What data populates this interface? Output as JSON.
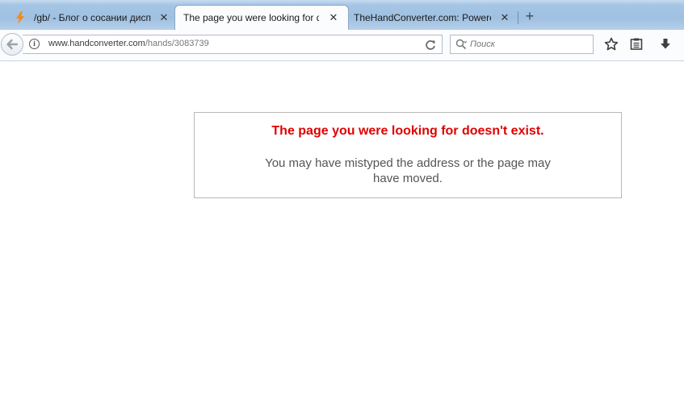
{
  "browser": {
    "tabs": [
      {
        "title": "/gb/ - Блог о сосании диспе",
        "favicon": "lightning-icon",
        "active": false
      },
      {
        "title": "The page you were looking for do",
        "active": true
      },
      {
        "title": "TheHandConverter.com: Powere",
        "active": false
      }
    ],
    "new_tab_label": "+",
    "close_glyph": "✕",
    "address": {
      "host": "www.handconverter.com",
      "path": "/hands/3083739"
    },
    "search": {
      "placeholder": "Поиск"
    }
  },
  "page": {
    "error_title": "The page you were looking for doesn't exist.",
    "error_message": "You may have mistyped the address or the page may have moved."
  },
  "colors": {
    "error_title": "#e00000",
    "tabstrip": "#a9c7e6",
    "favicon_orange": "#f08a1c"
  }
}
